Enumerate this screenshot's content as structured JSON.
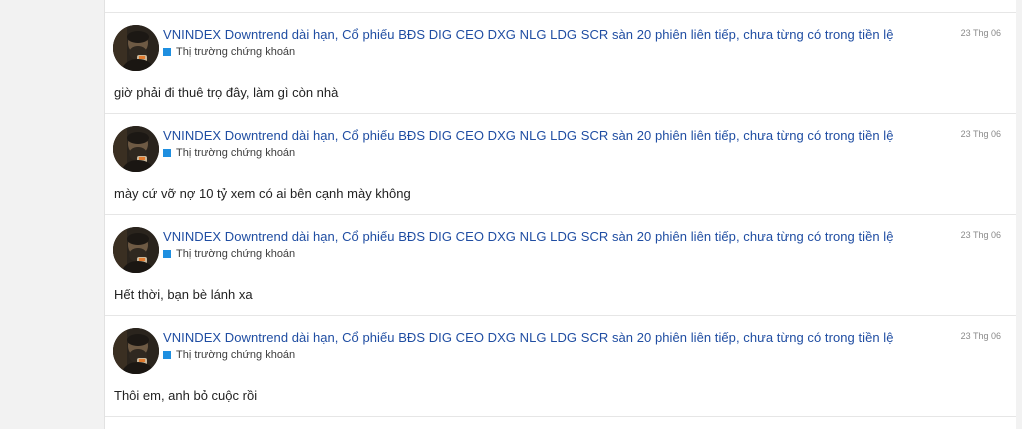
{
  "posts": [
    {
      "thread_title": "VNINDEX Downtrend dài hạn, Cổ phiếu BĐS DIG CEO DXG NLG LDG SCR sàn 20 phiên liên tiếp, chưa từng có trong tiền lệ",
      "forum": "Thị trường chứng khoán",
      "date": "23 Thg 06",
      "body": "giờ phải đi thuê trọ đây, làm gì còn nhà"
    },
    {
      "thread_title": "VNINDEX Downtrend dài hạn, Cổ phiếu BĐS DIG CEO DXG NLG LDG SCR sàn 20 phiên liên tiếp, chưa từng có trong tiền lệ",
      "forum": "Thị trường chứng khoán",
      "date": "23 Thg 06",
      "body": "mày cứ vỡ nợ 10 tỷ xem có ai bên cạnh mày không"
    },
    {
      "thread_title": "VNINDEX Downtrend dài hạn, Cổ phiếu BĐS DIG CEO DXG NLG LDG SCR sàn 20 phiên liên tiếp, chưa từng có trong tiền lệ",
      "forum": "Thị trường chứng khoán",
      "date": "23 Thg 06",
      "body": "Hết thời, bạn bè lánh xa"
    },
    {
      "thread_title": "VNINDEX Downtrend dài hạn, Cổ phiếu BĐS DIG CEO DXG NLG LDG SCR sàn 20 phiên liên tiếp, chưa từng có trong tiền lệ",
      "forum": "Thị trường chứng khoán",
      "date": "23 Thg 06",
      "body": "Thôi em, anh bỏ cuộc rồi"
    }
  ],
  "colors": {
    "link": "#1f4da2",
    "forum_icon": "#1f8fe0",
    "date": "#8a8a8a",
    "divider": "#e6e6e6"
  },
  "icons": {
    "avatar": "user-avatar-photo",
    "forum": "forum-square-icon"
  }
}
